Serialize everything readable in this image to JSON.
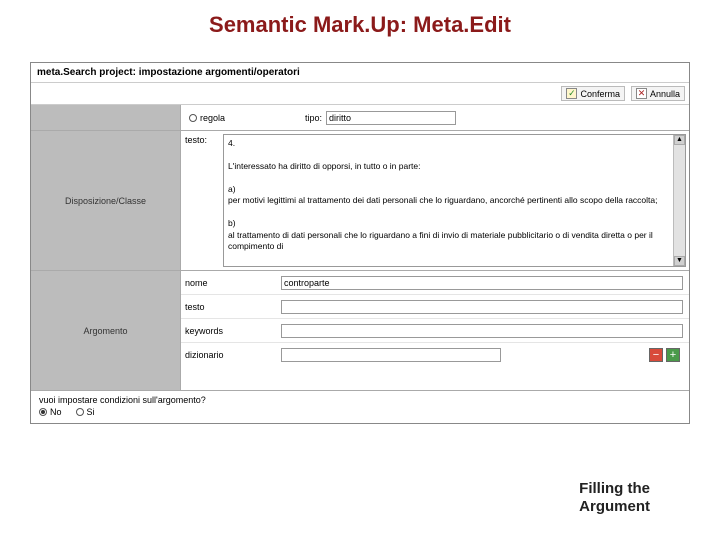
{
  "slide_title": "Semantic Mark.Up: Meta.Edit",
  "caption_line1": "Filling the",
  "caption_line2": "Argument",
  "app": {
    "title": "meta.Search project: impostazione argomenti/operatori",
    "confirm_label": "Conferma",
    "cancel_label": "Annulla"
  },
  "row1": {
    "radio_label": "regola",
    "tipo_label": "tipo:",
    "tipo_value": "diritto"
  },
  "row2": {
    "section_label": "Disposizione/Classe",
    "testo_label": "testo:",
    "body_html": "4.<br><br>L'interessato ha diritto di opporsi, in tutto o in parte:<br><br>a)<br>per motivi legittimi al trattamento dei dati personali che lo riguardano, ancorché pertinenti allo scopo della raccolta;<br><br>b)<br>al trattamento di dati personali che lo riguardano a fini di invio di materiale pubblicitario o di vendita diretta o per il compimento di"
  },
  "row3": {
    "section_label": "Argomento",
    "nome_label": "nome",
    "nome_value": "controparte",
    "testo_label": "testo",
    "testo_value": "",
    "keywords_label": "keywords",
    "keywords_value": "",
    "dizionario_label": "dizionario",
    "dizionario_value": ""
  },
  "bottom": {
    "question": "vuoi impostare condizioni sull'argomento?",
    "no_label": "No",
    "si_label": "Si"
  }
}
